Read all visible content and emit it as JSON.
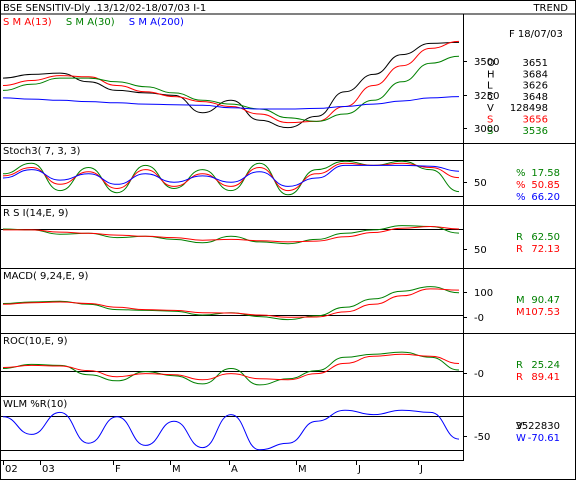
{
  "header": {
    "title": "BSE SENSITIV-Dly .13/12/02-18/07/03  I-1",
    "mode": "TREND",
    "date": "F 18/07/03"
  },
  "colors": {
    "price": "#000000",
    "sma13": "#ff0000",
    "sma30": "#008000",
    "sma200": "#0000ff",
    "green": "#008000",
    "red": "#ff0000",
    "blue": "#0000ff",
    "frame": "#000000",
    "grid": "#000000"
  },
  "quote": [
    {
      "k": "O",
      "v": "3651",
      "color": "#000000"
    },
    {
      "k": "H",
      "v": "3684",
      "color": "#000000"
    },
    {
      "k": "L",
      "v": "3626",
      "color": "#000000"
    },
    {
      "k": "C",
      "v": "3648",
      "color": "#000000"
    },
    {
      "k": "V",
      "v": "128498",
      "color": "#000000"
    },
    {
      "k": "S",
      "v": "3656",
      "color": "#ff0000"
    },
    {
      "k": "S",
      "v": "3536",
      "color": "#008000"
    }
  ],
  "panels": [
    {
      "id": "price",
      "legend": [
        {
          "text": "S M A(13)",
          "color": "#ff0000"
        },
        {
          "text": "S M A(30)",
          "color": "#008000"
        },
        {
          "text": "S M A(200)",
          "color": "#0000ff"
        }
      ],
      "ticks": [
        "3500",
        "3250",
        "3000"
      ],
      "values": []
    },
    {
      "id": "stoch",
      "legend": [
        {
          "text": "Stoch3( 7, 3, 3)",
          "color": "#000000"
        }
      ],
      "ticks": [
        "50"
      ],
      "values": [
        {
          "k": "%",
          "v": "17.58",
          "color": "#008000"
        },
        {
          "k": "%",
          "v": "50.85",
          "color": "#ff0000"
        },
        {
          "k": "%",
          "v": "66.20",
          "color": "#0000ff"
        }
      ]
    },
    {
      "id": "rsi",
      "legend": [
        {
          "text": "R S I(14,E, 9)",
          "color": "#000000"
        }
      ],
      "ticks": [
        "50"
      ],
      "values": [
        {
          "k": "R",
          "v": "62.50",
          "color": "#008000"
        },
        {
          "k": "R",
          "v": "72.13",
          "color": "#ff0000"
        }
      ]
    },
    {
      "id": "macd",
      "legend": [
        {
          "text": "MACD( 9,24,E, 9)",
          "color": "#000000"
        }
      ],
      "ticks": [
        "100",
        "-0"
      ],
      "values": [
        {
          "k": "M",
          "v": "90.47",
          "color": "#008000"
        },
        {
          "k": "M",
          "v": "107.53",
          "color": "#ff0000"
        }
      ]
    },
    {
      "id": "roc",
      "legend": [
        {
          "text": "ROC(10,E, 9)",
          "color": "#000000"
        }
      ],
      "ticks": [
        "-0"
      ],
      "values": [
        {
          "k": "R",
          "v": "25.24",
          "color": "#008000"
        },
        {
          "k": "R",
          "v": "89.41",
          "color": "#ff0000"
        }
      ]
    },
    {
      "id": "wlm",
      "legend": [
        {
          "text": "WLM %R(10)",
          "color": "#000000"
        }
      ],
      "ticks": [
        "-50"
      ],
      "values": [
        {
          "k": "V",
          "v": "3522830",
          "color": "#000000"
        },
        {
          "k": "W",
          "v": "-70.61",
          "color": "#0000ff"
        }
      ]
    }
  ],
  "x_labels": [
    "02",
    "03",
    "F",
    "M",
    "A",
    "M",
    "J",
    "J"
  ],
  "chart_data": [
    {
      "type": "line",
      "title": "BSE SENSITIV-Dly .13/12/02-18/07/03  I-1",
      "ylim": [
        2900,
        3700
      ],
      "x": [
        "13/12/02",
        "27/12/02",
        "10/01/03",
        "24/01/03",
        "07/02/03",
        "21/02/03",
        "07/03/03",
        "21/03/03",
        "04/04/03",
        "18/04/03",
        "02/05/03",
        "16/05/03",
        "30/05/03",
        "13/06/03",
        "27/06/03",
        "11/07/03",
        "18/07/03"
      ],
      "series": [
        {
          "name": "",
          "values": [
            3360,
            3390,
            3400,
            3330,
            3260,
            3240,
            3220,
            3080,
            3180,
            3020,
            2960,
            3050,
            3250,
            3390,
            3550,
            3640,
            3648
          ]
        },
        {
          "name": "S M A(13)",
          "values": [
            3300,
            3340,
            3380,
            3370,
            3300,
            3250,
            3210,
            3170,
            3130,
            3070,
            3000,
            3010,
            3130,
            3300,
            3460,
            3600,
            3656
          ]
        },
        {
          "name": "S M A(30)",
          "values": [
            3260,
            3310,
            3360,
            3360,
            3330,
            3290,
            3240,
            3180,
            3150,
            3110,
            3040,
            3010,
            3070,
            3180,
            3330,
            3480,
            3536
          ]
        },
        {
          "name": "S M A(200)",
          "values": [
            3200,
            3190,
            3180,
            3170,
            3160,
            3150,
            3145,
            3140,
            3120,
            3110,
            3110,
            3115,
            3130,
            3150,
            3175,
            3200,
            3210
          ]
        }
      ]
    },
    {
      "type": "line",
      "title": "Stoch3( 7, 3, 3)",
      "ylim": [
        0,
        100
      ],
      "x": [
        "13/12/02",
        "27/12/02",
        "10/01/03",
        "24/01/03",
        "07/02/03",
        "21/02/03",
        "07/03/03",
        "21/03/03",
        "04/04/03",
        "18/04/03",
        "02/05/03",
        "16/05/03",
        "30/05/03",
        "13/06/03",
        "27/06/03",
        "11/07/03",
        "18/07/03"
      ],
      "series": [
        {
          "name": "",
          "values": [
            60,
            85,
            20,
            75,
            15,
            80,
            25,
            70,
            20,
            85,
            10,
            70,
            90,
            80,
            90,
            70,
            17.58
          ]
        },
        {
          "name": "",
          "values": [
            55,
            75,
            35,
            65,
            25,
            70,
            30,
            60,
            30,
            75,
            20,
            60,
            85,
            80,
            85,
            75,
            50.85
          ]
        },
        {
          "name": "",
          "values": [
            50,
            70,
            45,
            60,
            35,
            60,
            40,
            55,
            40,
            65,
            30,
            50,
            80,
            80,
            80,
            78,
            66.2
          ]
        }
      ]
    },
    {
      "type": "line",
      "title": "R S I(14,E, 9)",
      "ylim": [
        0,
        100
      ],
      "x": [
        "13/12/02",
        "27/12/02",
        "10/01/03",
        "24/01/03",
        "07/02/03",
        "21/02/03",
        "07/03/03",
        "21/03/03",
        "04/04/03",
        "18/04/03",
        "02/05/03",
        "16/05/03",
        "30/05/03",
        "13/06/03",
        "27/06/03",
        "11/07/03",
        "18/07/03"
      ],
      "series": [
        {
          "name": "",
          "values": [
            72,
            70,
            60,
            62,
            52,
            55,
            48,
            40,
            55,
            42,
            38,
            48,
            62,
            70,
            80,
            78,
            62.5
          ]
        },
        {
          "name": "",
          "values": [
            70,
            70,
            65,
            62,
            58,
            55,
            52,
            46,
            48,
            45,
            42,
            44,
            54,
            64,
            74,
            78,
            72.13
          ]
        }
      ]
    },
    {
      "type": "line",
      "title": "MACD( 9,24,E, 9)",
      "ylim": [
        -120,
        160
      ],
      "x": [
        "13/12/02",
        "27/12/02",
        "10/01/03",
        "24/01/03",
        "07/02/03",
        "21/02/03",
        "07/03/03",
        "21/03/03",
        "04/04/03",
        "18/04/03",
        "02/05/03",
        "16/05/03",
        "30/05/03",
        "13/06/03",
        "27/06/03",
        "11/07/03",
        "18/07/03"
      ],
      "series": [
        {
          "name": "",
          "values": [
            20,
            30,
            35,
            15,
            -20,
            -25,
            -30,
            -55,
            -40,
            -65,
            -85,
            -60,
            -5,
            50,
            100,
            130,
            90.47
          ]
        },
        {
          "name": "",
          "values": [
            15,
            25,
            30,
            20,
            -5,
            -20,
            -25,
            -40,
            -42,
            -55,
            -70,
            -68,
            -35,
            15,
            70,
            115,
            107.53
          ]
        }
      ]
    },
    {
      "type": "line",
      "title": "ROC(10,E, 9)",
      "ylim": [
        -150,
        250
      ],
      "x": [
        "13/12/02",
        "27/12/02",
        "10/01/03",
        "24/01/03",
        "07/02/03",
        "21/02/03",
        "07/03/03",
        "21/03/03",
        "04/04/03",
        "18/04/03",
        "02/05/03",
        "16/05/03",
        "30/05/03",
        "13/06/03",
        "27/06/03",
        "11/07/03",
        "18/07/03"
      ],
      "series": [
        {
          "name": "",
          "values": [
            40,
            80,
            70,
            -20,
            -80,
            10,
            -30,
            -110,
            40,
            -120,
            -60,
            20,
            150,
            180,
            200,
            150,
            25.24
          ]
        },
        {
          "name": "",
          "values": [
            50,
            70,
            65,
            20,
            -40,
            -10,
            -20,
            -70,
            -10,
            -60,
            -70,
            -10,
            90,
            160,
            180,
            160,
            89.41
          ]
        }
      ]
    },
    {
      "type": "line",
      "title": "WLM %R(10)",
      "ylim": [
        -100,
        0
      ],
      "x": [
        "13/12/02",
        "27/12/02",
        "10/01/03",
        "24/01/03",
        "07/02/03",
        "21/02/03",
        "07/03/03",
        "21/03/03",
        "04/04/03",
        "18/04/03",
        "02/05/03",
        "16/05/03",
        "30/05/03",
        "13/06/03",
        "27/06/03",
        "11/07/03",
        "18/07/03"
      ],
      "series": [
        {
          "name": "",
          "values": [
            -20,
            -60,
            -10,
            -80,
            -20,
            -85,
            -30,
            -90,
            -15,
            -95,
            -80,
            -30,
            -5,
            -15,
            -5,
            -10,
            -70.61
          ]
        }
      ]
    }
  ]
}
